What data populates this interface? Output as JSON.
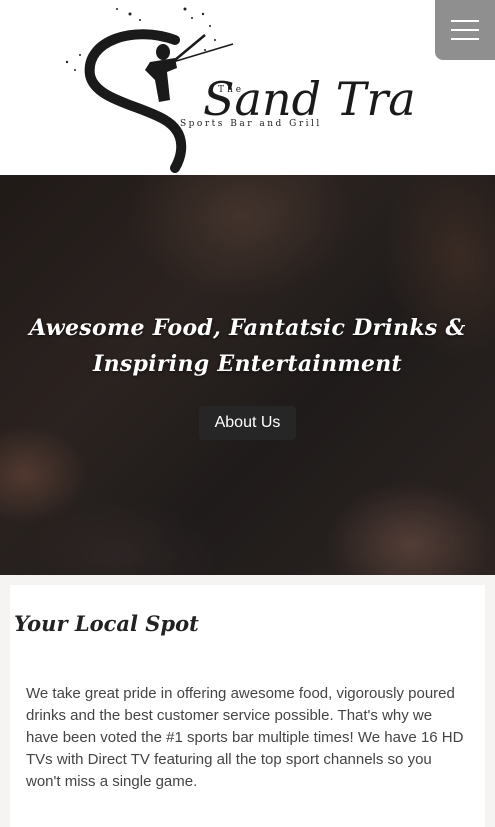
{
  "header": {
    "logo": {
      "pre_title": "The",
      "title": "Sand Trap",
      "tagline": "Sports Bar and Grill"
    },
    "menu_icon": "hamburger-menu-icon",
    "menu_button_color": "#8f8f8f"
  },
  "hero": {
    "title_line1": "Awesome Food, Fantatsic Drinks &",
    "title_line2": "Inspiring Entertainment",
    "button_label": "About Us"
  },
  "section": {
    "title": "Your Local Spot",
    "body": "We take great pride in offering awesome food, vigorously poured drinks and the best customer service possible. That's why we have been voted the #1 sports bar multiple times! We have 16 HD TVs with Direct TV featuring all the top sport channels so you won't miss a single game."
  }
}
